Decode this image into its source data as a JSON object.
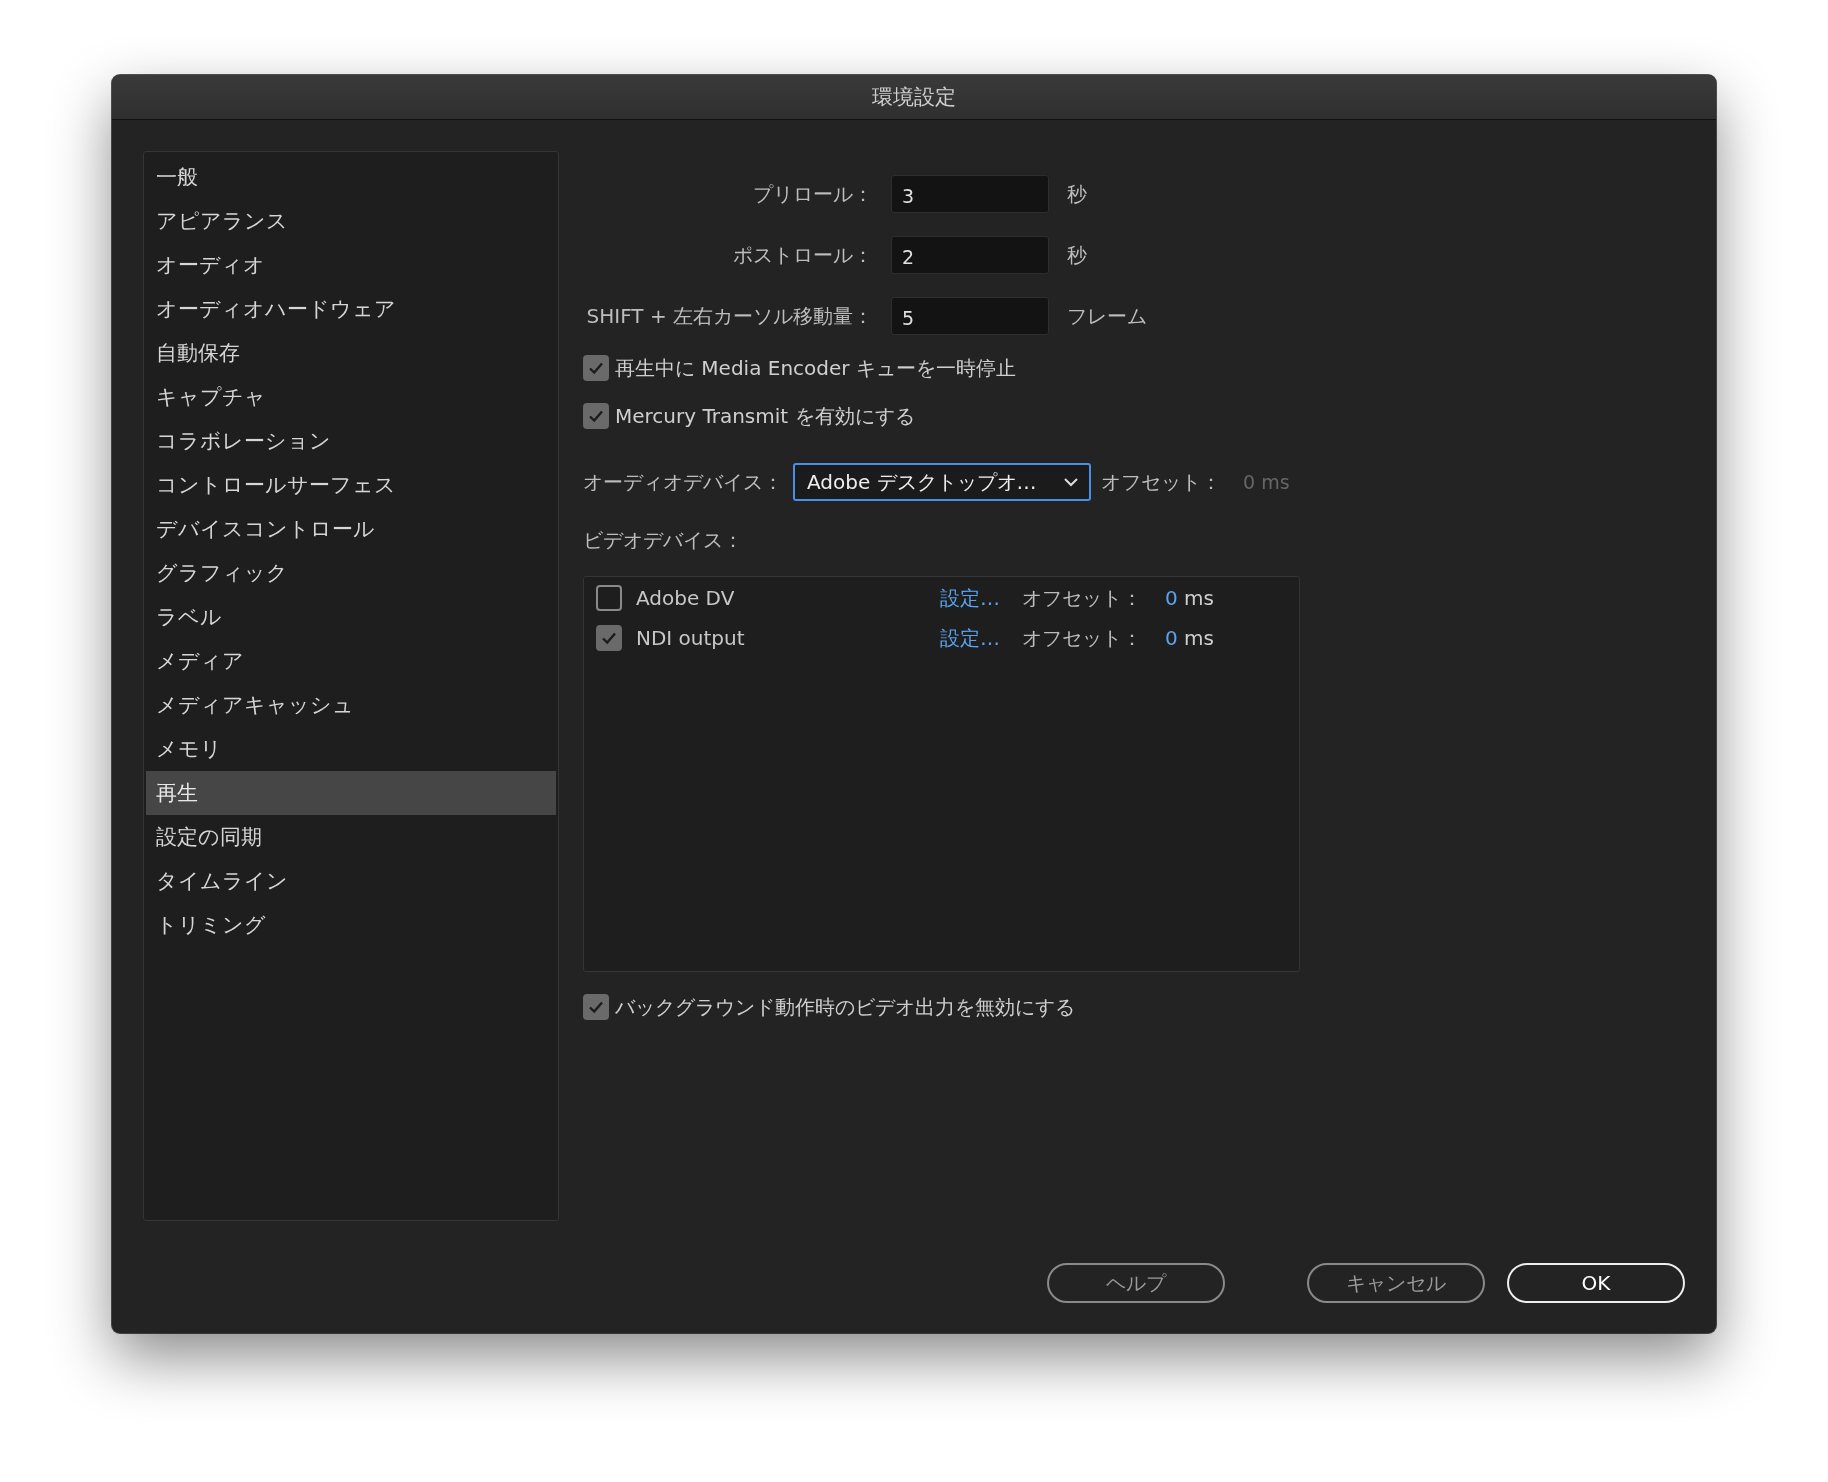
{
  "window": {
    "title": "環境設定"
  },
  "sidebar": {
    "items": [
      {
        "label": "一般",
        "selected": false
      },
      {
        "label": "アピアランス",
        "selected": false
      },
      {
        "label": "オーディオ",
        "selected": false
      },
      {
        "label": "オーディオハードウェア",
        "selected": false
      },
      {
        "label": "自動保存",
        "selected": false
      },
      {
        "label": "キャプチャ",
        "selected": false
      },
      {
        "label": "コラボレーション",
        "selected": false
      },
      {
        "label": "コントロールサーフェス",
        "selected": false
      },
      {
        "label": "デバイスコントロール",
        "selected": false
      },
      {
        "label": "グラフィック",
        "selected": false
      },
      {
        "label": "ラベル",
        "selected": false
      },
      {
        "label": "メディア",
        "selected": false
      },
      {
        "label": "メディアキャッシュ",
        "selected": false
      },
      {
        "label": "メモリ",
        "selected": false
      },
      {
        "label": "再生",
        "selected": true
      },
      {
        "label": "設定の同期",
        "selected": false
      },
      {
        "label": "タイムライン",
        "selected": false
      },
      {
        "label": "トリミング",
        "selected": false
      }
    ]
  },
  "playback": {
    "fields": [
      {
        "label": "プリロール：",
        "value": "3",
        "unit": "秒"
      },
      {
        "label": "ポストロール：",
        "value": "2",
        "unit": "秒"
      },
      {
        "label": "SHIFT + 左右カーソル移動量：",
        "value": "5",
        "unit": "フレーム"
      }
    ],
    "options": [
      {
        "label": "再生中に Media Encoder キューを一時停止",
        "checked": true
      },
      {
        "label": "Mercury Transmit を有効にする",
        "checked": true
      }
    ],
    "audio_device": {
      "label": "オーディオデバイス：",
      "value": "Adobe デスクトップオ…",
      "offset_label": "オフセット：",
      "offset_value": "0 ms"
    },
    "video_devices": {
      "label": "ビデオデバイス：",
      "rows": [
        {
          "name": "Adobe DV",
          "checked": false,
          "settings_link": "設定…",
          "offset_label": "オフセット：",
          "offset_value": "0",
          "offset_unit": "ms"
        },
        {
          "name": "NDI output",
          "checked": true,
          "settings_link": "設定…",
          "offset_label": "オフセット：",
          "offset_value": "0",
          "offset_unit": "ms"
        }
      ]
    },
    "background_option": {
      "label": "バックグラウンド動作時のビデオ出力を無効にする",
      "checked": true
    }
  },
  "buttons": [
    {
      "label": "ヘルプ",
      "kind": "secondary"
    },
    {
      "label": "キャンセル",
      "kind": "secondary"
    },
    {
      "label": "OK",
      "kind": "primary"
    }
  ]
}
